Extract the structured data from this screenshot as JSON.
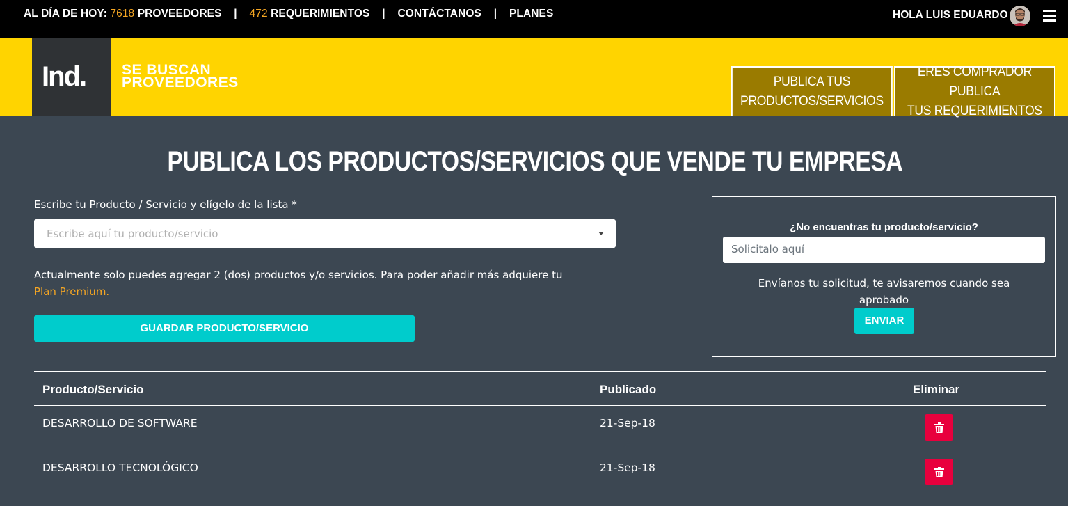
{
  "topbar": {
    "stats_prefix": "AL DÍA DE HOY:",
    "providers_count": "7618",
    "providers_label": "PROVEEDORES",
    "sep1": "|",
    "requirements_count": "472",
    "requirements_label": "REQUERIMIENTOS",
    "sep2": "|",
    "contact_label": "CONTÁCTANOS",
    "sep3": "|",
    "plans_label": "PLANES",
    "greeting": "HOLA LUIS EDUARDO"
  },
  "header": {
    "logo_text": "Ind.",
    "tagline_line1": "SE BUSCAN",
    "tagline_line2": "PROVEEDORES",
    "btn_publish_line1": "PUBLICA TUS",
    "btn_publish_line2": "PRODUCTOS/SERVICIOS",
    "btn_buyer_line1": "ERES COMPRADOR PUBLICA",
    "btn_buyer_line2": "TUS REQUERIMIENTOS",
    "colors": {
      "yellow": "#ffd400",
      "button": "#9a7b00"
    }
  },
  "main": {
    "title": "PUBLICA LOS PRODUCTOS/SERVICIOS QUE VENDE TU EMPRESA",
    "field_label": "Escribe tu Producto / Servicio y elígelo de la lista *",
    "field_placeholder": "Escribe aquí tu producto/servicio",
    "note_text": "Actualmente solo puedes agregar 2 (dos) productos y/o servicios. Para poder añadir más adquiere tu",
    "note_link": "Plan Premium.",
    "save_button": "GUARDAR PRODUCTO/SERVICIO"
  },
  "request": {
    "title": "¿No encuentras tu producto/servicio?",
    "input_placeholder": "Solicitalo aquí",
    "text": "Envíanos tu solicitud, te avisaremos cuando sea aprobado",
    "send_button": "ENVIAR"
  },
  "table": {
    "headers": {
      "product": "Producto/Servicio",
      "published": "Publicado",
      "delete": "Eliminar"
    },
    "rows": [
      {
        "product": "DESARROLLO DE SOFTWARE",
        "published": "21-Sep-18",
        "delete_icon": "trash-icon"
      },
      {
        "product": "DESARROLLO TECNOLÓGICO",
        "published": "21-Sep-18",
        "delete_icon": "trash-icon"
      }
    ]
  },
  "accent_colors": {
    "teal": "#00cccc",
    "orange": "#f5a623",
    "red": "#e8003d",
    "background": "#3c4752"
  }
}
